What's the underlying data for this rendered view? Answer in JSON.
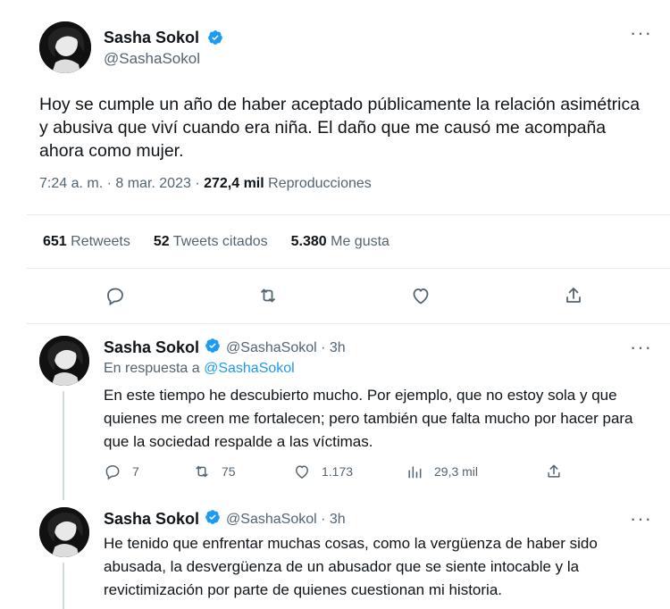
{
  "main_tweet": {
    "author_name": "Sasha Sokol",
    "author_handle": "@SashaSokol",
    "more_label": "···",
    "text": "Hoy se cumple un año de haber aceptado públicamente la relación asimétrica y abusiva que viví cuando era niña. El daño que me causó me acompaña ahora como mujer.",
    "time": "7:24 a. m. · 8 mar. 2023 · ",
    "views_count": "272,4 mil",
    "views_label": " Reproducciones",
    "stats": {
      "retweets_count": "651",
      "retweets_label": " Retweets",
      "quotes_count": "52",
      "quotes_label": " Tweets citados",
      "likes_count": "5.380",
      "likes_label": " Me gusta"
    },
    "actions": [
      "reply-icon",
      "retweet-icon",
      "like-icon",
      "share-icon"
    ]
  },
  "replies": [
    {
      "author_name": "Sasha Sokol",
      "author_handle": "@SashaSokol · 3h",
      "more_label": "···",
      "in_reply_prefix": "En respuesta a ",
      "in_reply_handle": "@SashaSokol",
      "text": "En este tiempo he descubierto mucho. Por ejemplo, que no estoy sola y que quienes me creen me fortalecen; pero también que falta mucho por hacer para que la sociedad respalde a las víctimas.",
      "replies_count": "7",
      "retweets_count": "75",
      "likes_count": "1.173",
      "views_count": "29,3 mil"
    },
    {
      "author_name": "Sasha Sokol",
      "author_handle": "@SashaSokol · 3h",
      "more_label": "···",
      "text": "He tenido que enfrentar muchas cosas, como la vergüenza de haber sido abusada, la desvergüenza de un abusador que se siente intocable y la revictimización por parte de quienes cuestionan mi historia."
    }
  ],
  "colors": {
    "link": "#1d9bf0",
    "verified": "#1d9bf0",
    "secondary_text": "#536471",
    "divider": "#e6ecf0"
  }
}
